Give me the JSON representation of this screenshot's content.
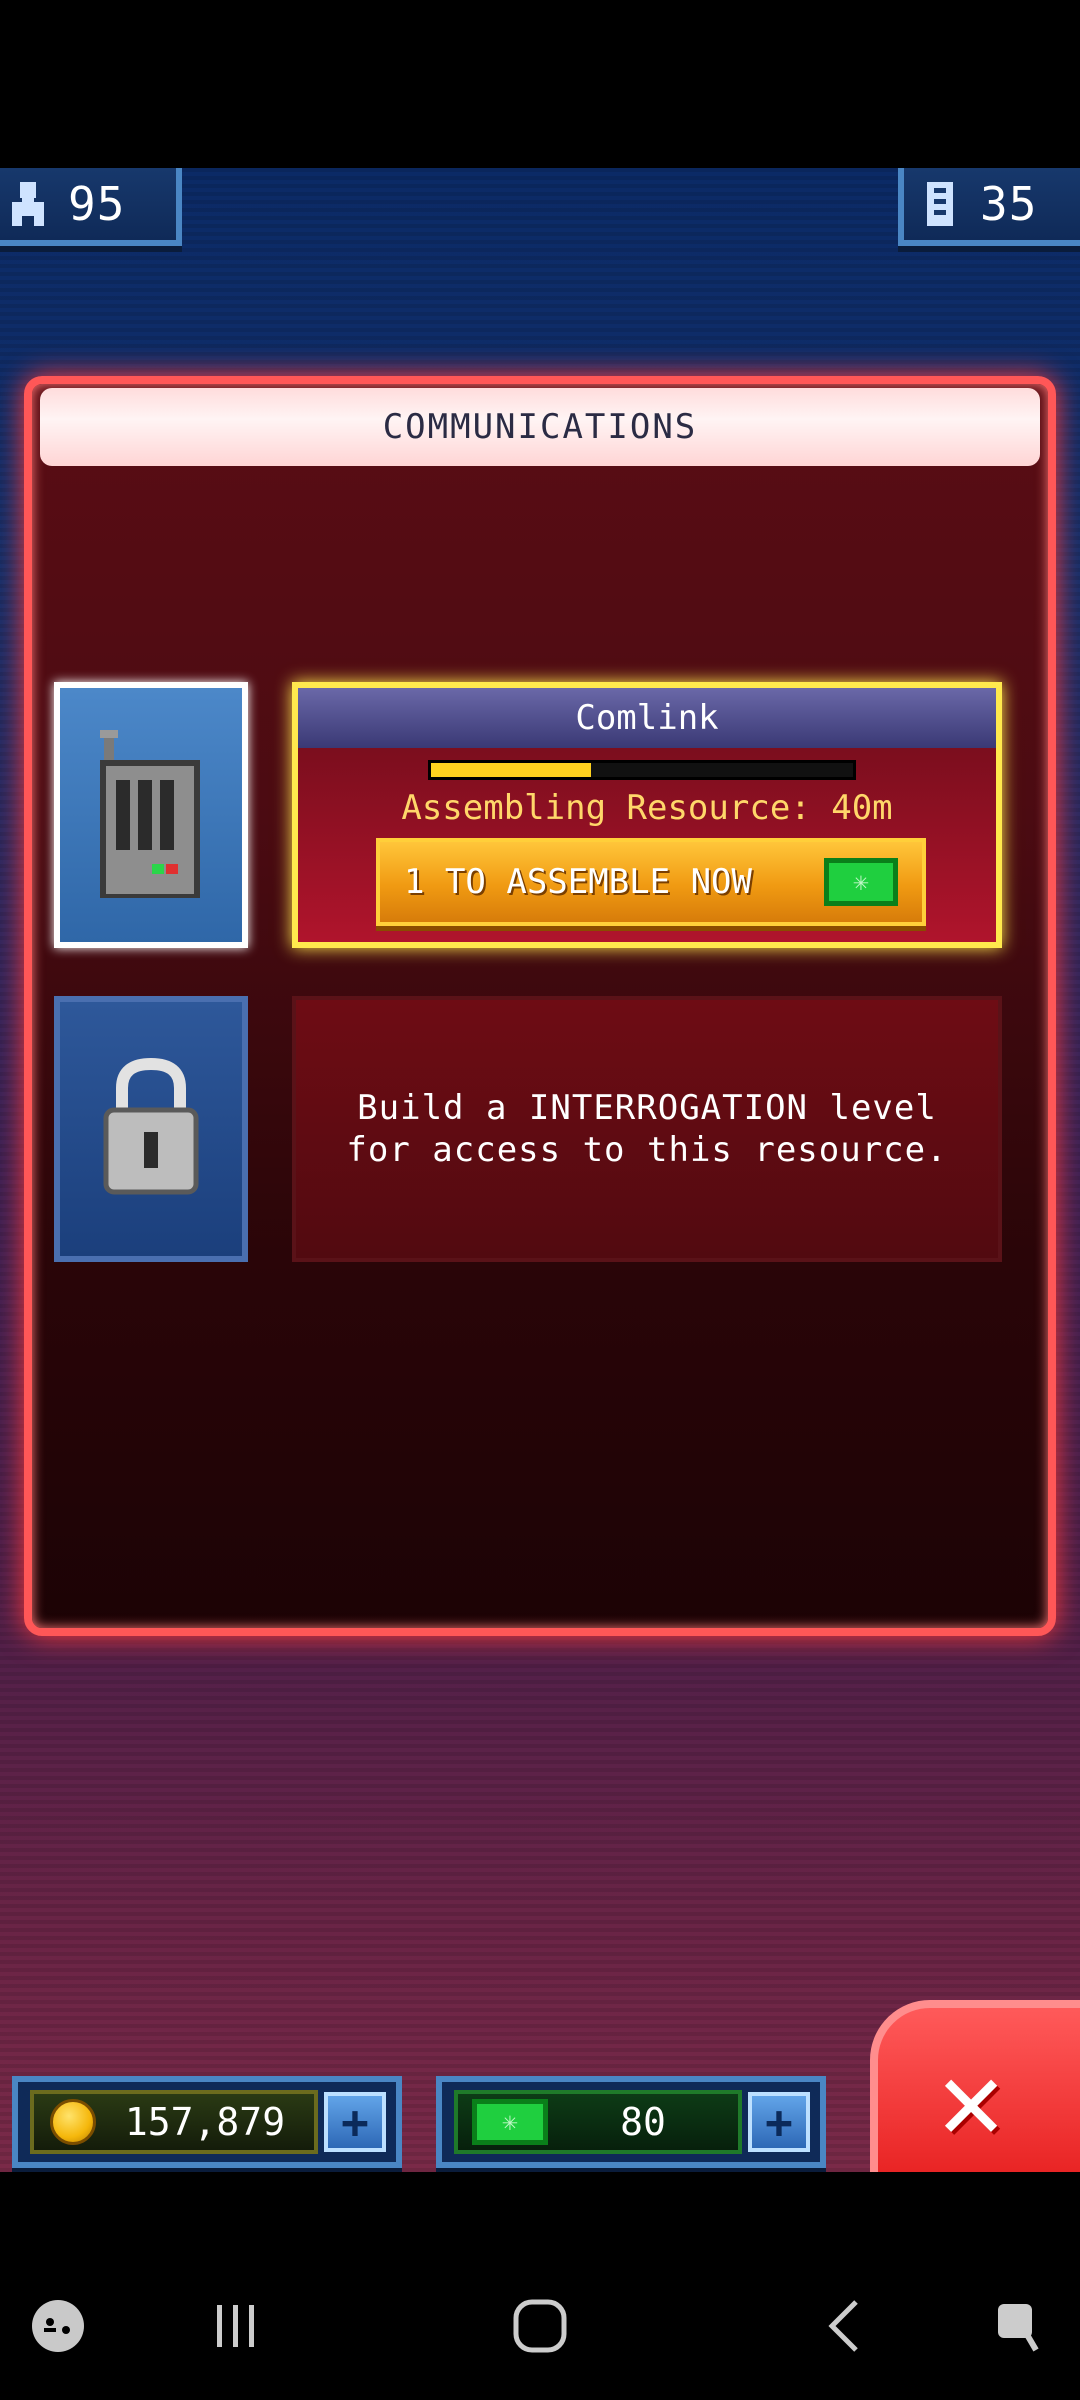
{
  "hud": {
    "population": "95",
    "floors": "35"
  },
  "panel": {
    "title": "COMMUNICATIONS"
  },
  "resources": [
    {
      "name": "Comlink",
      "status": "Assembling Resource: 40m",
      "progress": 0.38,
      "assemble_button": "1 TO ASSEMBLE NOW",
      "currency_icon": "cash-icon"
    },
    {
      "locked_message": "Build a INTERROGATION level for access to this resource."
    }
  ],
  "wallet": {
    "coins": "157,879",
    "cash": "80"
  },
  "colors": {
    "panel_border": "#ff5757",
    "active_card_border": "#ffe94d",
    "progress_fill": "#ffd21f",
    "cash_green": "#1fcf3f"
  }
}
